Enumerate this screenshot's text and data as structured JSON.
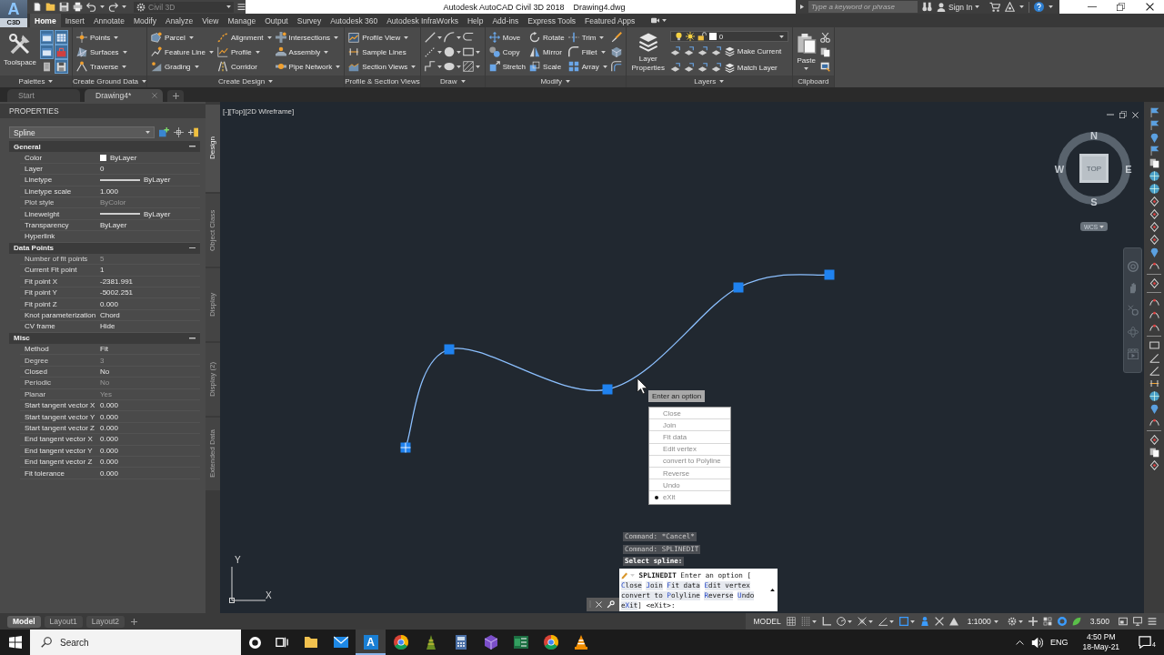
{
  "title_bar": {
    "app_letter": "A",
    "app_badge": "C3D",
    "workspace": "Civil 3D",
    "title": "Autodesk AutoCAD Civil 3D 2018",
    "file_name": "Drawing4.dwg",
    "search": {
      "placeholder": "Type a keyword or phrase"
    },
    "sign_in": "Sign In"
  },
  "ribbon": {
    "tabs": [
      {
        "label": "Home",
        "selected": true
      },
      {
        "label": "Insert",
        "selected": false
      },
      {
        "label": "Annotate",
        "selected": false
      },
      {
        "label": "Modify",
        "selected": false
      },
      {
        "label": "Analyze",
        "selected": false
      },
      {
        "label": "View",
        "selected": false
      },
      {
        "label": "Manage",
        "selected": false
      },
      {
        "label": "Output",
        "selected": false
      },
      {
        "label": "Survey",
        "selected": false
      },
      {
        "label": "Autodesk 360",
        "selected": false
      },
      {
        "label": "Autodesk InfraWorks",
        "selected": false
      },
      {
        "label": "Help",
        "selected": false
      },
      {
        "label": "Add-ins",
        "selected": false
      },
      {
        "label": "Express Tools",
        "selected": false
      },
      {
        "label": "Featured Apps",
        "selected": false
      }
    ],
    "panels": [
      {
        "kind": "palettes",
        "title": "Palettes",
        "menu": true,
        "large": {
          "label": "Toolspace"
        },
        "toggles": [
          {
            "on": true
          },
          {
            "on": true
          },
          {
            "on": true
          },
          {
            "on": true
          },
          {
            "on": false
          },
          {
            "on": true
          }
        ]
      },
      {
        "kind": "columns",
        "title": "Create Ground Data",
        "menu": true,
        "columns": [
          [
            {
              "label": "Points",
              "dropdown": true
            },
            {
              "label": "Surfaces",
              "dropdown": true
            },
            {
              "label": "Traverse",
              "dropdown": true
            }
          ]
        ]
      },
      {
        "kind": "columns",
        "title": "Create Design",
        "menu": true,
        "columns": [
          [
            {
              "label": "Parcel",
              "dropdown": true
            },
            {
              "label": "Feature Line",
              "dropdown": true
            },
            {
              "label": "Grading",
              "dropdown": true
            }
          ],
          [
            {
              "label": "Alignment",
              "dropdown": true
            },
            {
              "label": "Profile",
              "dropdown": true
            },
            {
              "label": "Corridor",
              "dropdown": false
            }
          ],
          [
            {
              "label": "Intersections",
              "dropdown": true
            },
            {
              "label": "Assembly",
              "dropdown": true
            },
            {
              "label": "Pipe Network",
              "dropdown": true
            }
          ]
        ]
      },
      {
        "kind": "columns",
        "title": "Profile & Section Views",
        "menu": false,
        "columns": [
          [
            {
              "label": "Profile View",
              "dropdown": true
            },
            {
              "label": "Sample Lines",
              "dropdown": false
            },
            {
              "label": "Section Views",
              "dropdown": true
            }
          ]
        ]
      },
      {
        "kind": "tools",
        "title": "Draw",
        "menu": true,
        "tools": [
          {
            "dropdown": true
          },
          {
            "dropdown": true
          },
          {
            "dropdown": false
          },
          {
            "dropdown": true
          },
          {
            "dropdown": true
          },
          {
            "dropdown": true
          },
          {
            "dropdown": true
          },
          {
            "dropdown": true
          },
          {
            "dropdown": true
          }
        ]
      },
      {
        "kind": "columns",
        "title": "Modify",
        "menu": true,
        "columns": [
          [
            {
              "label": "Move",
              "dropdown": false
            },
            {
              "label": "Copy",
              "dropdown": false
            },
            {
              "label": "Stretch",
              "dropdown": false
            }
          ],
          [
            {
              "label": "Rotate",
              "dropdown": false
            },
            {
              "label": "Mirror",
              "dropdown": false
            },
            {
              "label": "Scale",
              "dropdown": false
            }
          ],
          [
            {
              "label": "Trim",
              "dropdown": true
            },
            {
              "label": "Fillet",
              "dropdown": true
            },
            {
              "label": "Array",
              "dropdown": true
            }
          ]
        ]
      },
      {
        "kind": "layers",
        "title": "Layers",
        "menu": true,
        "large": {
          "label": "Layer Properties"
        },
        "current_layer": "0",
        "buttons": [
          {
            "label": "Make Current"
          },
          {
            "label": "Match Layer"
          }
        ]
      },
      {
        "kind": "clipboard",
        "title": "Clipboard",
        "menu": false,
        "large": {
          "label": "Paste",
          "dropdown": true
        }
      }
    ]
  },
  "doc_tabs": [
    {
      "label": "Start",
      "selected": false
    },
    {
      "label": "Drawing4*",
      "selected": true
    }
  ],
  "properties": {
    "title": "PROPERTIES",
    "selection": "Spline",
    "sections": [
      {
        "title": "General",
        "expanded": true,
        "rows": [
          {
            "label": "Color",
            "value": "ByLayer",
            "kind": "swatch",
            "disabled": false
          },
          {
            "label": "Layer",
            "value": "0",
            "kind": "text",
            "disabled": false
          },
          {
            "label": "Linetype",
            "value": "ByLayer",
            "kind": "line",
            "disabled": false
          },
          {
            "label": "Linetype scale",
            "value": "1.000",
            "kind": "text",
            "disabled": false
          },
          {
            "label": "Plot style",
            "value": "ByColor",
            "kind": "text",
            "disabled": true
          },
          {
            "label": "Lineweight",
            "value": "ByLayer",
            "kind": "line",
            "disabled": false
          },
          {
            "label": "Transparency",
            "value": "ByLayer",
            "kind": "text",
            "disabled": false
          },
          {
            "label": "Hyperlink",
            "kind": "text",
            "disabled": false
          }
        ]
      },
      {
        "title": "Data Points",
        "expanded": true,
        "rows": [
          {
            "label": "Number of fit points",
            "value": "5",
            "kind": "text",
            "disabled": true
          },
          {
            "label": "Current Fit point",
            "value": "1",
            "kind": "text",
            "disabled": false
          },
          {
            "label": "Fit point X",
            "value": "-2381.991",
            "kind": "text",
            "disabled": false
          },
          {
            "label": "Fit point Y",
            "value": "-5002.251",
            "kind": "text",
            "disabled": false
          },
          {
            "label": "Fit point Z",
            "value": "0.000",
            "kind": "text",
            "disabled": false
          },
          {
            "label": "Knot parameterization",
            "value": "Chord",
            "kind": "text",
            "disabled": false
          },
          {
            "label": "CV frame",
            "value": "Hide",
            "kind": "text",
            "disabled": false
          }
        ]
      },
      {
        "title": "Misc",
        "expanded": true,
        "rows": [
          {
            "label": "Method",
            "value": "Fit",
            "kind": "text",
            "disabled": false
          },
          {
            "label": "Degree",
            "value": "3",
            "kind": "text",
            "disabled": true
          },
          {
            "label": "Closed",
            "value": "No",
            "kind": "text",
            "disabled": false
          },
          {
            "label": "Periodic",
            "value": "No",
            "kind": "text",
            "disabled": true
          },
          {
            "label": "Planar",
            "value": "Yes",
            "kind": "text",
            "disabled": true
          },
          {
            "label": "Start tangent vector X",
            "value": "0.000",
            "kind": "text",
            "disabled": false
          },
          {
            "label": "Start tangent vector Y",
            "value": "0.000",
            "kind": "text",
            "disabled": false
          },
          {
            "label": "Start tangent vector Z",
            "value": "0.000",
            "kind": "text",
            "disabled": false
          },
          {
            "label": "End tangent vector X",
            "value": "0.000",
            "kind": "text",
            "disabled": false
          },
          {
            "label": "End tangent vector Y",
            "value": "0.000",
            "kind": "text",
            "disabled": false
          },
          {
            "label": "End tangent vector Z",
            "value": "0.000",
            "kind": "text",
            "disabled": false
          },
          {
            "label": "Fit tolerance",
            "value": "0.000",
            "kind": "text",
            "disabled": false
          }
        ]
      }
    ]
  },
  "palette_tabs": [
    {
      "label": "Design",
      "selected": true
    },
    {
      "label": "Object Class",
      "selected": false
    },
    {
      "label": "Display",
      "selected": false
    },
    {
      "label": "Display (2)",
      "selected": false
    },
    {
      "label": "Extended Data",
      "selected": false
    }
  ],
  "viewport": {
    "controls": "[-][Top][2D Wireframe]",
    "viewcube": {
      "north": "N",
      "south": "S",
      "east": "E",
      "west": "W",
      "face": "TOP",
      "ucs": "WCS"
    },
    "ucs_icon": {
      "x": "X",
      "y": "Y"
    },
    "option_menu": {
      "title": "Enter an option",
      "items": [
        {
          "label": "Close",
          "selected": false
        },
        {
          "label": "Join",
          "selected": false
        },
        {
          "label": "Fit data",
          "selected": false
        },
        {
          "label": "Edit vertex",
          "selected": false
        },
        {
          "label": "convert to Polyline",
          "selected": false
        },
        {
          "label": "Reverse",
          "selected": false
        },
        {
          "label": "Undo",
          "selected": false
        },
        {
          "label": "eXit",
          "selected": true
        }
      ]
    },
    "command_history": [
      {
        "text": "Command: *Cancel*",
        "latest": false
      },
      {
        "text": "Command: SPLINEDIT",
        "latest": false
      },
      {
        "text": "Select spline:",
        "latest": true
      }
    ],
    "command_line": {
      "command": "SPLINEDIT",
      "prompt": "Enter an option [",
      "options": [
        {
          "key": "C",
          "after": "lose"
        },
        {
          "key": "J",
          "after": "oin"
        },
        {
          "key": "F",
          "after": "it data"
        },
        {
          "key": "E",
          "after": "dit vertex"
        },
        {
          "before": "convert to ",
          "key": "P",
          "after": "olyline"
        },
        {
          "key": "R",
          "after": "everse"
        },
        {
          "key": "U",
          "after": "ndo"
        },
        {
          "before": "e",
          "key": "X",
          "after": "it"
        }
      ],
      "suffix": "] <eXit>:"
    }
  },
  "layout_tabs": [
    {
      "label": "Model",
      "selected": true
    },
    {
      "label": "Layout1",
      "selected": false
    },
    {
      "label": "Layout2",
      "selected": false
    }
  ],
  "status_bar": {
    "space": "MODEL",
    "scale": "1:1000",
    "readout": "3.500",
    "tools": [
      {
        "on": false,
        "dropdown": false
      },
      {
        "on": false,
        "dropdown": true
      },
      {
        "on": false,
        "dropdown": false
      },
      {
        "on": false,
        "dropdown": true
      },
      {
        "on": false,
        "dropdown": true
      },
      {
        "on": false,
        "dropdown": true
      },
      {
        "on": true,
        "dropdown": true
      },
      {
        "on": true,
        "dropdown": false
      },
      {
        "on": false,
        "dropdown": false
      },
      {
        "on": false,
        "dropdown": false
      },
      {
        "on": false,
        "dropdown": true
      },
      {
        "on": false,
        "dropdown": false
      },
      {
        "on": false,
        "dropdown": false
      },
      {
        "on": true,
        "dropdown": false
      },
      {
        "on": true,
        "dropdown": false
      },
      {
        "on": false,
        "dropdown": false
      },
      {
        "on": false,
        "dropdown": false
      },
      {
        "on": false,
        "dropdown": false
      }
    ]
  },
  "taskbar": {
    "search": {
      "placeholder": "Search"
    },
    "apps": [
      {
        "active": false
      },
      {
        "active": false
      },
      {
        "active": true,
        "letter": "A"
      },
      {
        "active": false
      },
      {
        "active": false
      },
      {
        "active": false
      },
      {
        "active": false
      },
      {
        "active": false
      },
      {
        "active": false
      },
      {
        "active": false
      }
    ],
    "language": "ENG",
    "time": "4:50 PM",
    "date": "18-May-21",
    "notifications": "4"
  }
}
